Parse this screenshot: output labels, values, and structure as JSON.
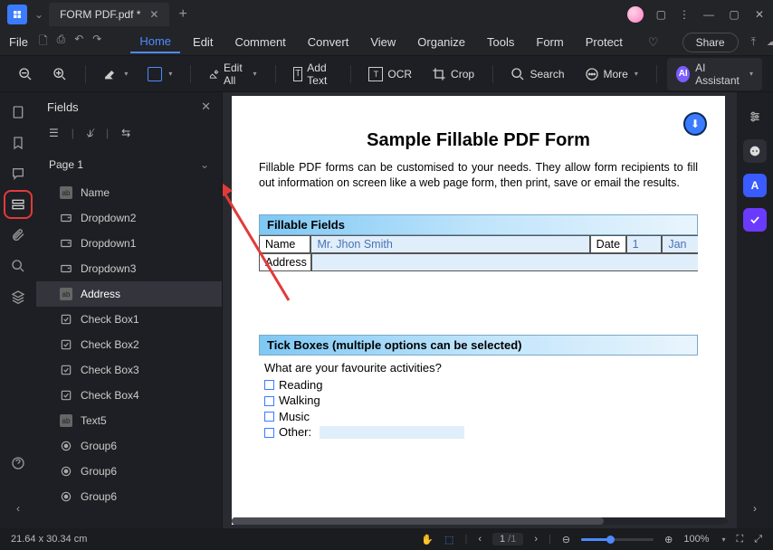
{
  "titlebar": {
    "tab_title": "FORM PDF.pdf *"
  },
  "menubar": {
    "file": "File",
    "items": [
      "Home",
      "Edit",
      "Comment",
      "Convert",
      "View",
      "Organize",
      "Tools",
      "Form",
      "Protect"
    ],
    "active": "Home",
    "share": "Share"
  },
  "toolbar": {
    "edit_all": "Edit All",
    "add_text": "Add Text",
    "ocr": "OCR",
    "crop": "Crop",
    "search": "Search",
    "more": "More",
    "ai": "AI Assistant",
    "ai_badge": "AI"
  },
  "fields_panel": {
    "title": "Fields",
    "page": "Page 1",
    "items": [
      {
        "type": "text",
        "label": "Name"
      },
      {
        "type": "dropdown",
        "label": "Dropdown2"
      },
      {
        "type": "dropdown",
        "label": "Dropdown1"
      },
      {
        "type": "dropdown",
        "label": "Dropdown3"
      },
      {
        "type": "text",
        "label": "Address"
      },
      {
        "type": "checkbox",
        "label": "Check Box1"
      },
      {
        "type": "checkbox",
        "label": "Check Box2"
      },
      {
        "type": "checkbox",
        "label": "Check Box3"
      },
      {
        "type": "checkbox",
        "label": "Check Box4"
      },
      {
        "type": "text",
        "label": "Text5"
      },
      {
        "type": "radio",
        "label": "Group6"
      },
      {
        "type": "radio",
        "label": "Group6"
      },
      {
        "type": "radio",
        "label": "Group6"
      }
    ],
    "selected": 4
  },
  "document": {
    "title": "Sample Fillable PDF Form",
    "subtitle": "Fillable PDF forms can be customised to your needs. They allow form recipients to fill out information on screen like a web page form, then print, save or email the results.",
    "section1": "Fillable Fields",
    "labels": {
      "name": "Name",
      "date": "Date",
      "address": "Address"
    },
    "values": {
      "name": "Mr. Jhon Smith",
      "day": "1",
      "month": "Jan"
    },
    "section2": "Tick Boxes (multiple options can be selected)",
    "tick_question": "What are your favourite activities?",
    "tick_options": [
      "Reading",
      "Walking",
      "Music",
      "Other:"
    ]
  },
  "statusbar": {
    "dims": "21.64 x 30.34 cm",
    "page_cur": "1",
    "page_total": "/1",
    "zoom": "100%"
  }
}
